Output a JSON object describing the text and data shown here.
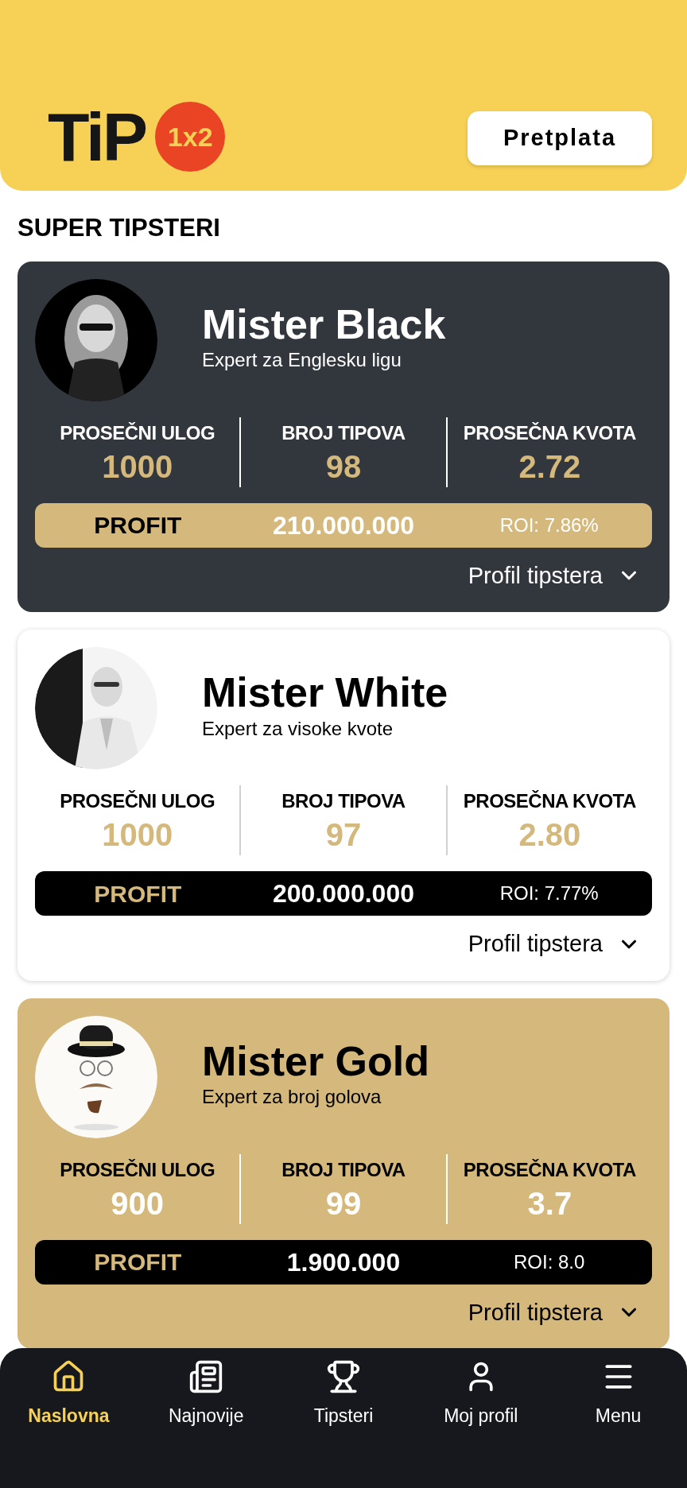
{
  "header": {
    "logo": {
      "text": "TiP",
      "badge": "1x2"
    },
    "subscribe_button": "Pretplata"
  },
  "section_title": "SUPER TIPSTERI",
  "tipsters": [
    {
      "kind": "dark",
      "name": "Mister Black",
      "subtitle": "Expert za Englesku ligu",
      "stats": [
        {
          "label": "PROSEČNI ULOG",
          "value": "1000"
        },
        {
          "label": "BROJ TIPOVA",
          "value": "98"
        },
        {
          "label": "PROSEČNA KVOTA",
          "value": "2.72"
        }
      ],
      "profit_label": "PROFIT",
      "profit": "210.000.000",
      "roi": "ROI: 7.86%",
      "profile_link": "Profil tipstera",
      "expanded": false
    },
    {
      "kind": "light",
      "name": "Mister White",
      "subtitle": "Expert za visoke kvote",
      "stats": [
        {
          "label": "PROSEČNI ULOG",
          "value": "1000"
        },
        {
          "label": "BROJ TIPOVA",
          "value": "97"
        },
        {
          "label": "PROSEČNA KVOTA",
          "value": "2.80"
        }
      ],
      "profit_label": "PROFIT",
      "profit": "200.000.000",
      "roi": "ROI: 7.77%",
      "profile_link": "Profil tipstera",
      "expanded": false
    },
    {
      "kind": "gold",
      "name": "Mister Gold",
      "subtitle": "Expert za broj golova",
      "stats": [
        {
          "label": "PROSEČNI ULOG",
          "value": "900"
        },
        {
          "label": "BROJ TIPOVA",
          "value": "99"
        },
        {
          "label": "PROSEČNA KVOTA",
          "value": "3.7"
        }
      ],
      "profit_label": "PROFIT",
      "profit": "1.900.000",
      "roi": "ROI: 8.0",
      "profile_link": "Profil tipstera",
      "expanded": false
    }
  ],
  "bottom_nav": [
    {
      "kind": "home",
      "label": "Naslovna",
      "selected": true
    },
    {
      "kind": "news",
      "label": "Najnovije",
      "selected": false
    },
    {
      "kind": "trophy",
      "label": "Tipsteri",
      "selected": false
    },
    {
      "kind": "user",
      "label": "Moj profil",
      "selected": false
    },
    {
      "kind": "menu",
      "label": "Menu",
      "selected": false
    }
  ]
}
